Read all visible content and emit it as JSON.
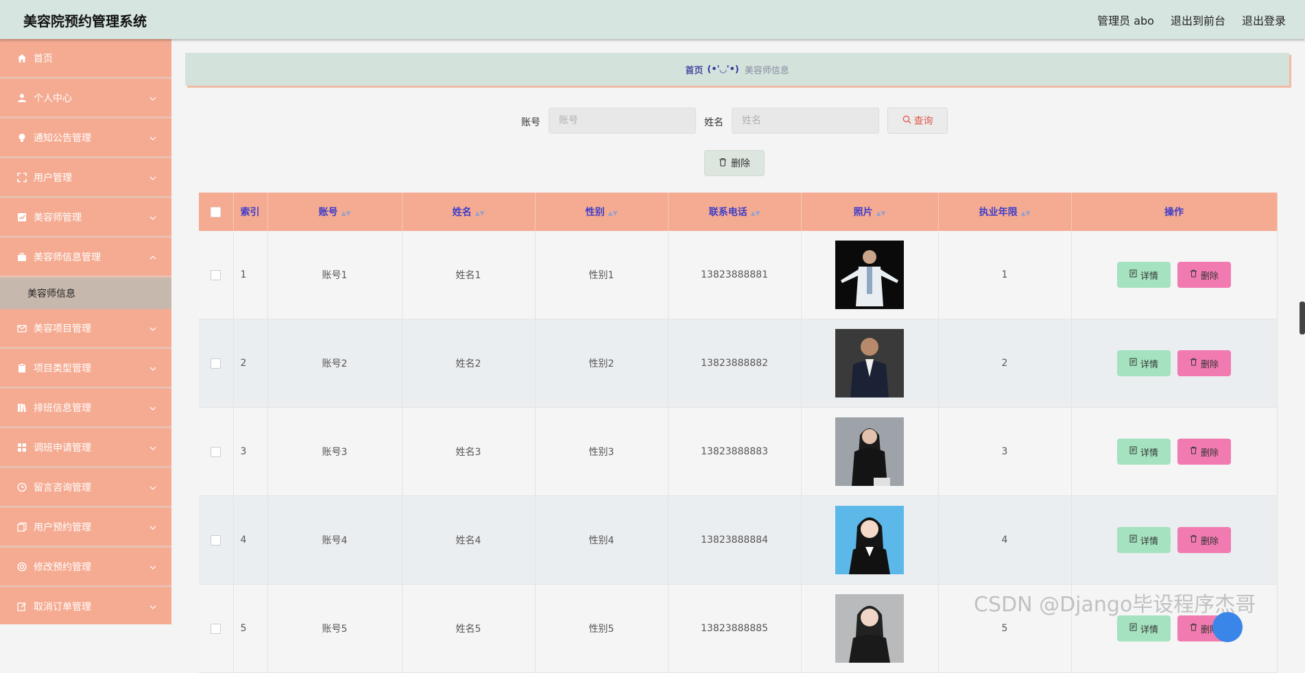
{
  "header": {
    "app_title": "美容院预约管理系统",
    "admin_label": "管理员 abo",
    "front_label": "退出到前台",
    "logout_label": "退出登录"
  },
  "sidebar": {
    "items": [
      {
        "label": "首页",
        "icon": "home-icon"
      },
      {
        "label": "个人中心",
        "icon": "user-icon"
      },
      {
        "label": "通知公告管理",
        "icon": "bulb-icon"
      },
      {
        "label": "用户管理",
        "icon": "fullscreen-icon"
      },
      {
        "label": "美容师管理",
        "icon": "chart-icon"
      },
      {
        "label": "美容师信息管理",
        "icon": "briefcase-icon"
      },
      {
        "label": "美容项目管理",
        "icon": "mail-icon"
      },
      {
        "label": "项目类型管理",
        "icon": "clipboard-icon"
      },
      {
        "label": "排班信息管理",
        "icon": "books-icon"
      },
      {
        "label": "调班申请管理",
        "icon": "grid-icon"
      },
      {
        "label": "留言咨询管理",
        "icon": "clock-icon"
      },
      {
        "label": "用户预约管理",
        "icon": "copy-icon"
      },
      {
        "label": "修改预约管理",
        "icon": "lifebuoy-icon"
      },
      {
        "label": "取消订单管理",
        "icon": "edit-icon"
      }
    ],
    "active_sub": "美容师信息"
  },
  "breadcrumb": {
    "home": "首页",
    "face": "(•'◡'•)",
    "current": "美容师信息"
  },
  "search": {
    "account_label": "账号",
    "account_placeholder": "账号",
    "name_label": "姓名",
    "name_placeholder": "姓名",
    "search_button": "查询",
    "bulk_delete_button": "删除"
  },
  "table": {
    "columns": {
      "index": "索引",
      "account": "账号",
      "name": "姓名",
      "gender": "性别",
      "phone": "联系电话",
      "photo": "照片",
      "years": "执业年限",
      "actions": "操作"
    },
    "detail_label": "详情",
    "delete_label": "删除",
    "rows": [
      {
        "index": "1",
        "account": "账号1",
        "name": "姓名1",
        "gender": "性别1",
        "phone": "13823888881",
        "years": "1"
      },
      {
        "index": "2",
        "account": "账号2",
        "name": "姓名2",
        "gender": "性别2",
        "phone": "13823888882",
        "years": "2"
      },
      {
        "index": "3",
        "account": "账号3",
        "name": "姓名3",
        "gender": "性别3",
        "phone": "13823888883",
        "years": "3"
      },
      {
        "index": "4",
        "account": "账号4",
        "name": "姓名4",
        "gender": "性别4",
        "phone": "13823888884",
        "years": "4"
      },
      {
        "index": "5",
        "account": "账号5",
        "name": "姓名5",
        "gender": "性别5",
        "phone": "13823888885",
        "years": "5"
      }
    ]
  },
  "watermark": "CSDN @Django毕设程序杰哥",
  "colors": {
    "header_bg": "#d6e5df",
    "sidebar_bg": "#f5ab92",
    "table_header_bg": "#f5ab92",
    "header_text": "#3d3dc8",
    "detail_btn": "#a5e2bf",
    "delete_btn": "#f17bb0"
  }
}
